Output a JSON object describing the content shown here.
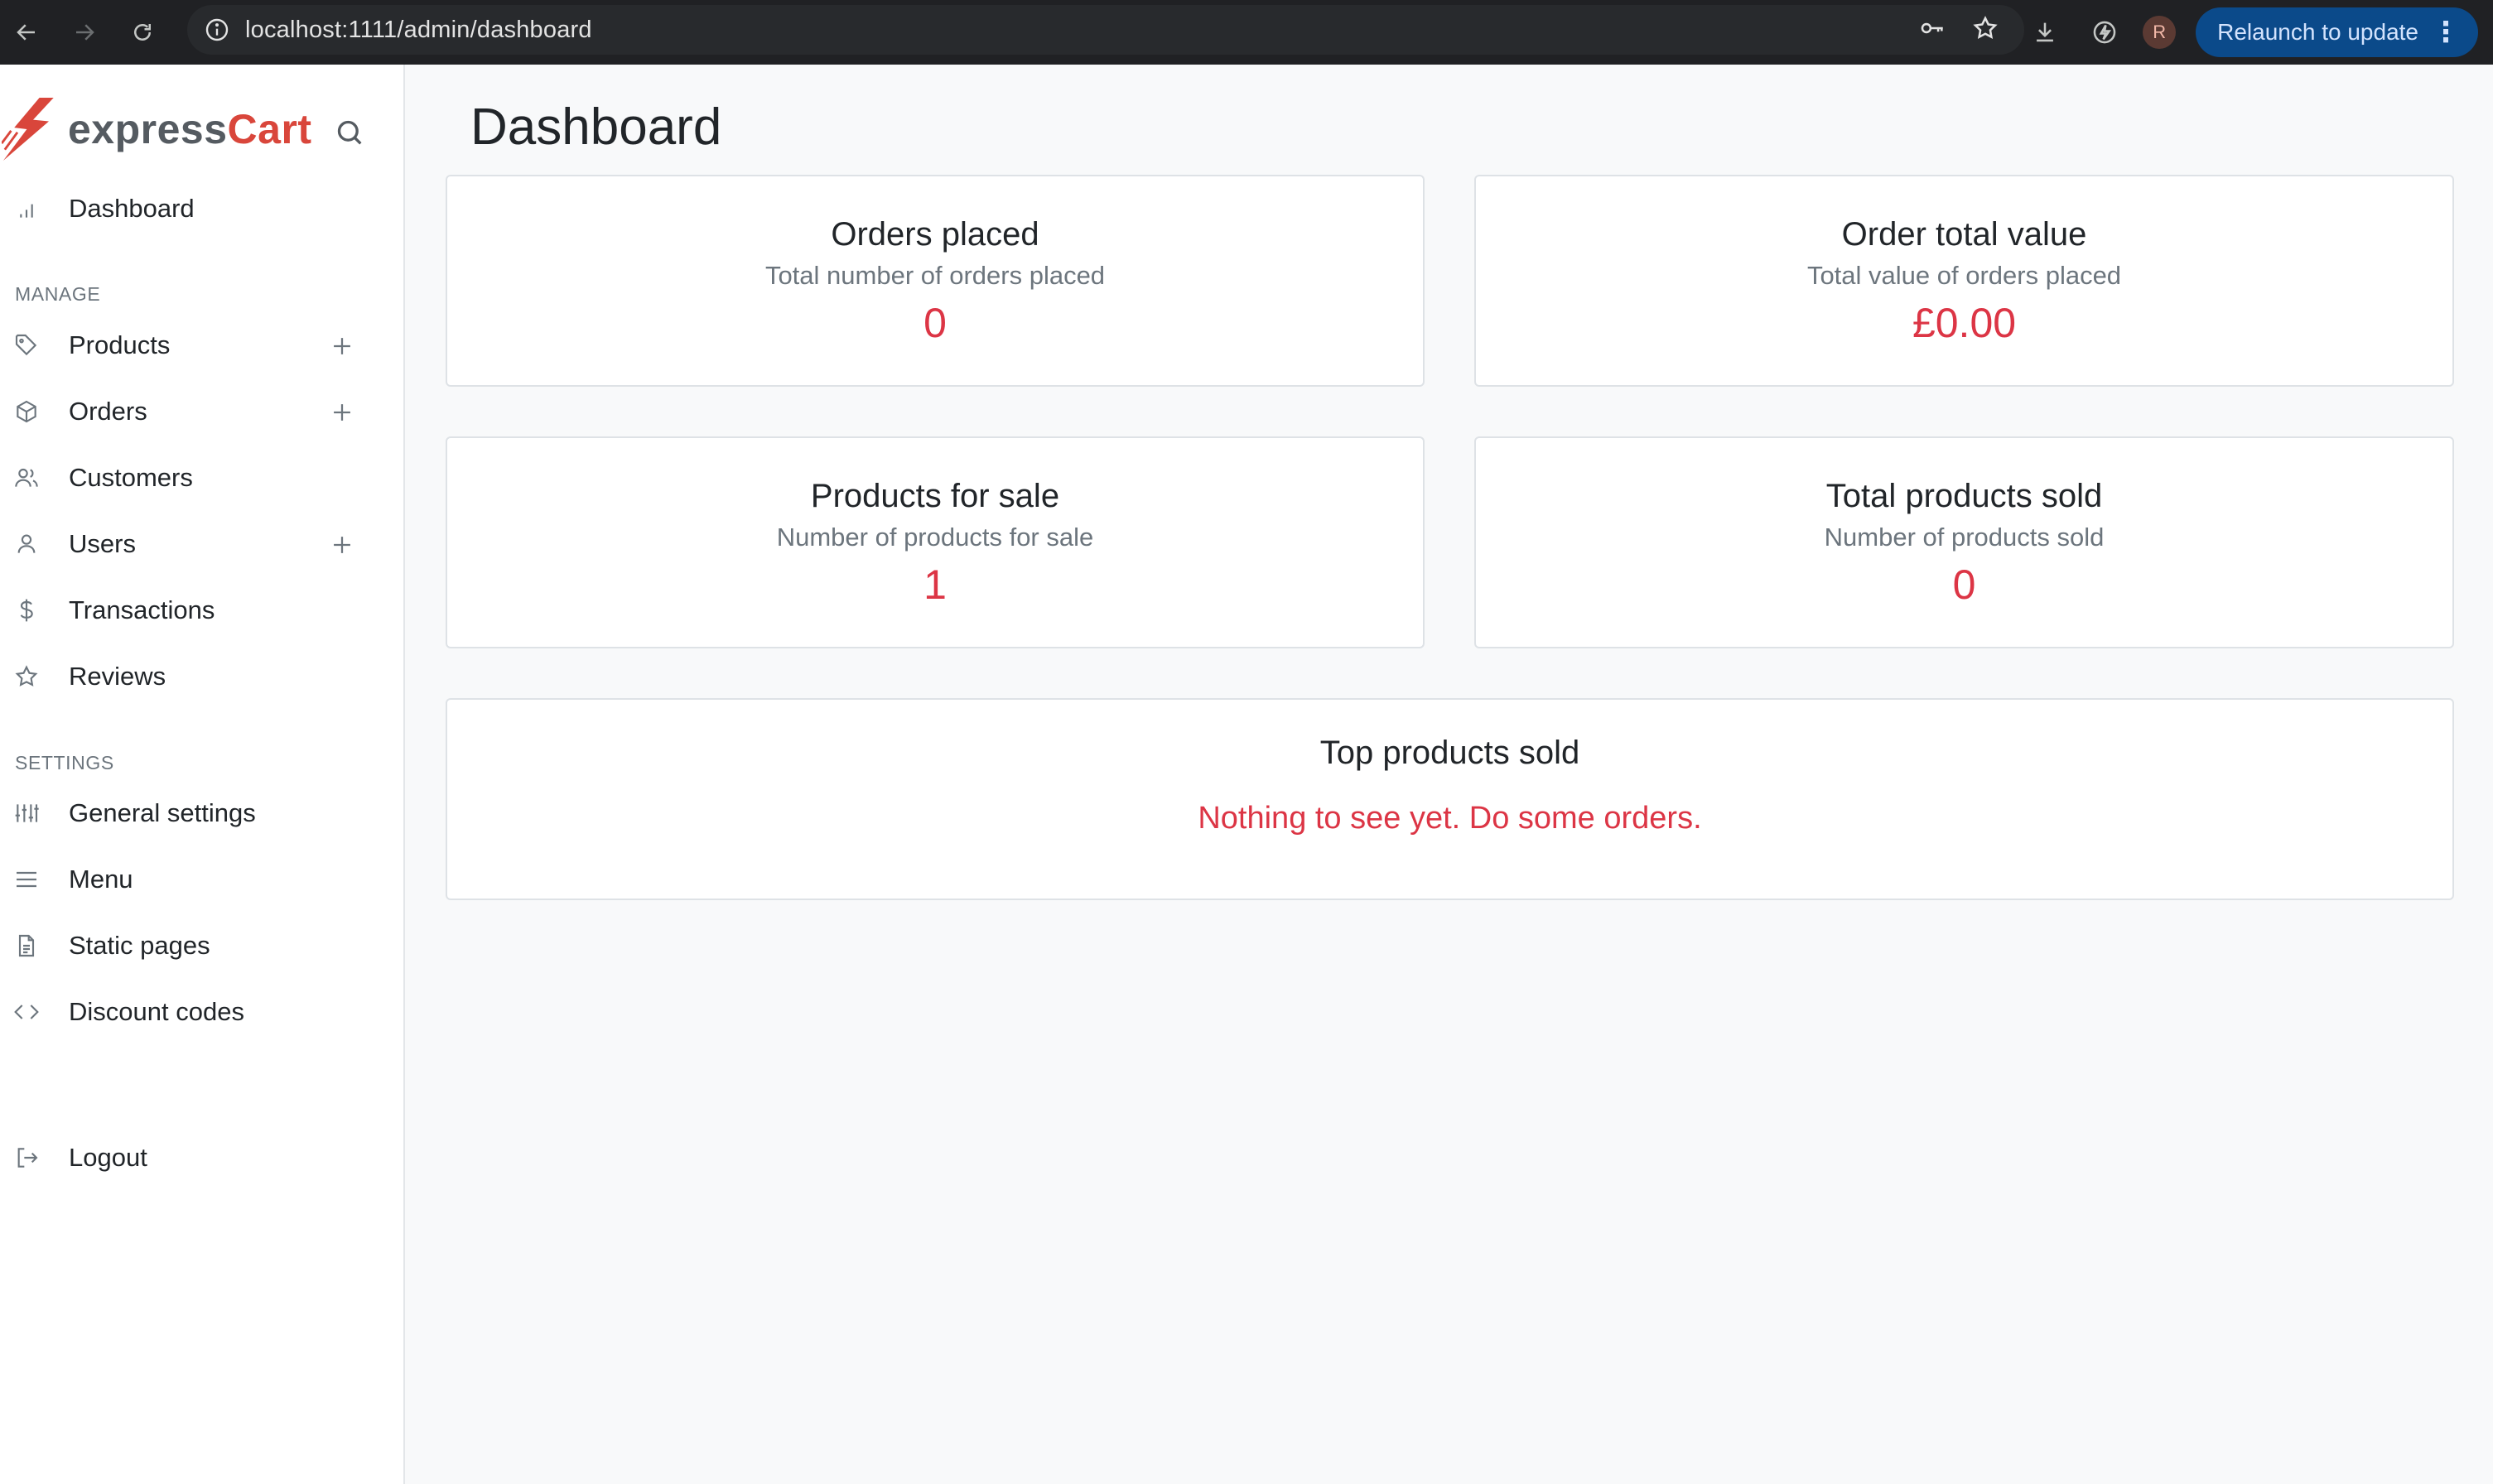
{
  "browser": {
    "url": "localhost:1111/admin/dashboard",
    "relaunch_label": "Relaunch to update",
    "profile_initial": "R",
    "icons": [
      "back-icon",
      "forward-icon",
      "reload-icon",
      "site-info-icon",
      "key-icon",
      "bookmark-star-icon",
      "download-icon",
      "extension-icon",
      "kebab-menu-icon"
    ]
  },
  "brand": {
    "part1": "express",
    "part2": "Cart",
    "accent": "#d9463b"
  },
  "sidebar": {
    "dashboard": "Dashboard",
    "manage_heading": "MANAGE",
    "manage_items": [
      {
        "label": "Products",
        "icon": "tag-icon",
        "has_add": true
      },
      {
        "label": "Orders",
        "icon": "package-icon",
        "has_add": true
      },
      {
        "label": "Customers",
        "icon": "users-icon",
        "has_add": false
      },
      {
        "label": "Users",
        "icon": "user-icon",
        "has_add": true
      },
      {
        "label": "Transactions",
        "icon": "dollar-icon",
        "has_add": false
      },
      {
        "label": "Reviews",
        "icon": "star-icon",
        "has_add": false
      }
    ],
    "settings_heading": "SETTINGS",
    "settings_items": [
      {
        "label": "General settings",
        "icon": "sliders-icon"
      },
      {
        "label": "Menu",
        "icon": "menu-icon"
      },
      {
        "label": "Static pages",
        "icon": "file-icon"
      },
      {
        "label": "Discount codes",
        "icon": "code-icon"
      }
    ],
    "logout": "Logout"
  },
  "main": {
    "title": "Dashboard",
    "cards": [
      {
        "title": "Orders placed",
        "subtitle": "Total number of orders placed",
        "value": "0"
      },
      {
        "title": "Order total value",
        "subtitle": "Total value of orders placed",
        "value": "£0.00"
      },
      {
        "title": "Products for sale",
        "subtitle": "Number of products for sale",
        "value": "1"
      },
      {
        "title": "Total products sold",
        "subtitle": "Number of products sold",
        "value": "0"
      }
    ],
    "top_products": {
      "title": "Top products sold",
      "message": "Nothing to see yet. Do some orders."
    }
  },
  "colors": {
    "value_red": "#dc3545",
    "chrome_bg": "#202124",
    "page_bg": "#f8f9fa"
  }
}
